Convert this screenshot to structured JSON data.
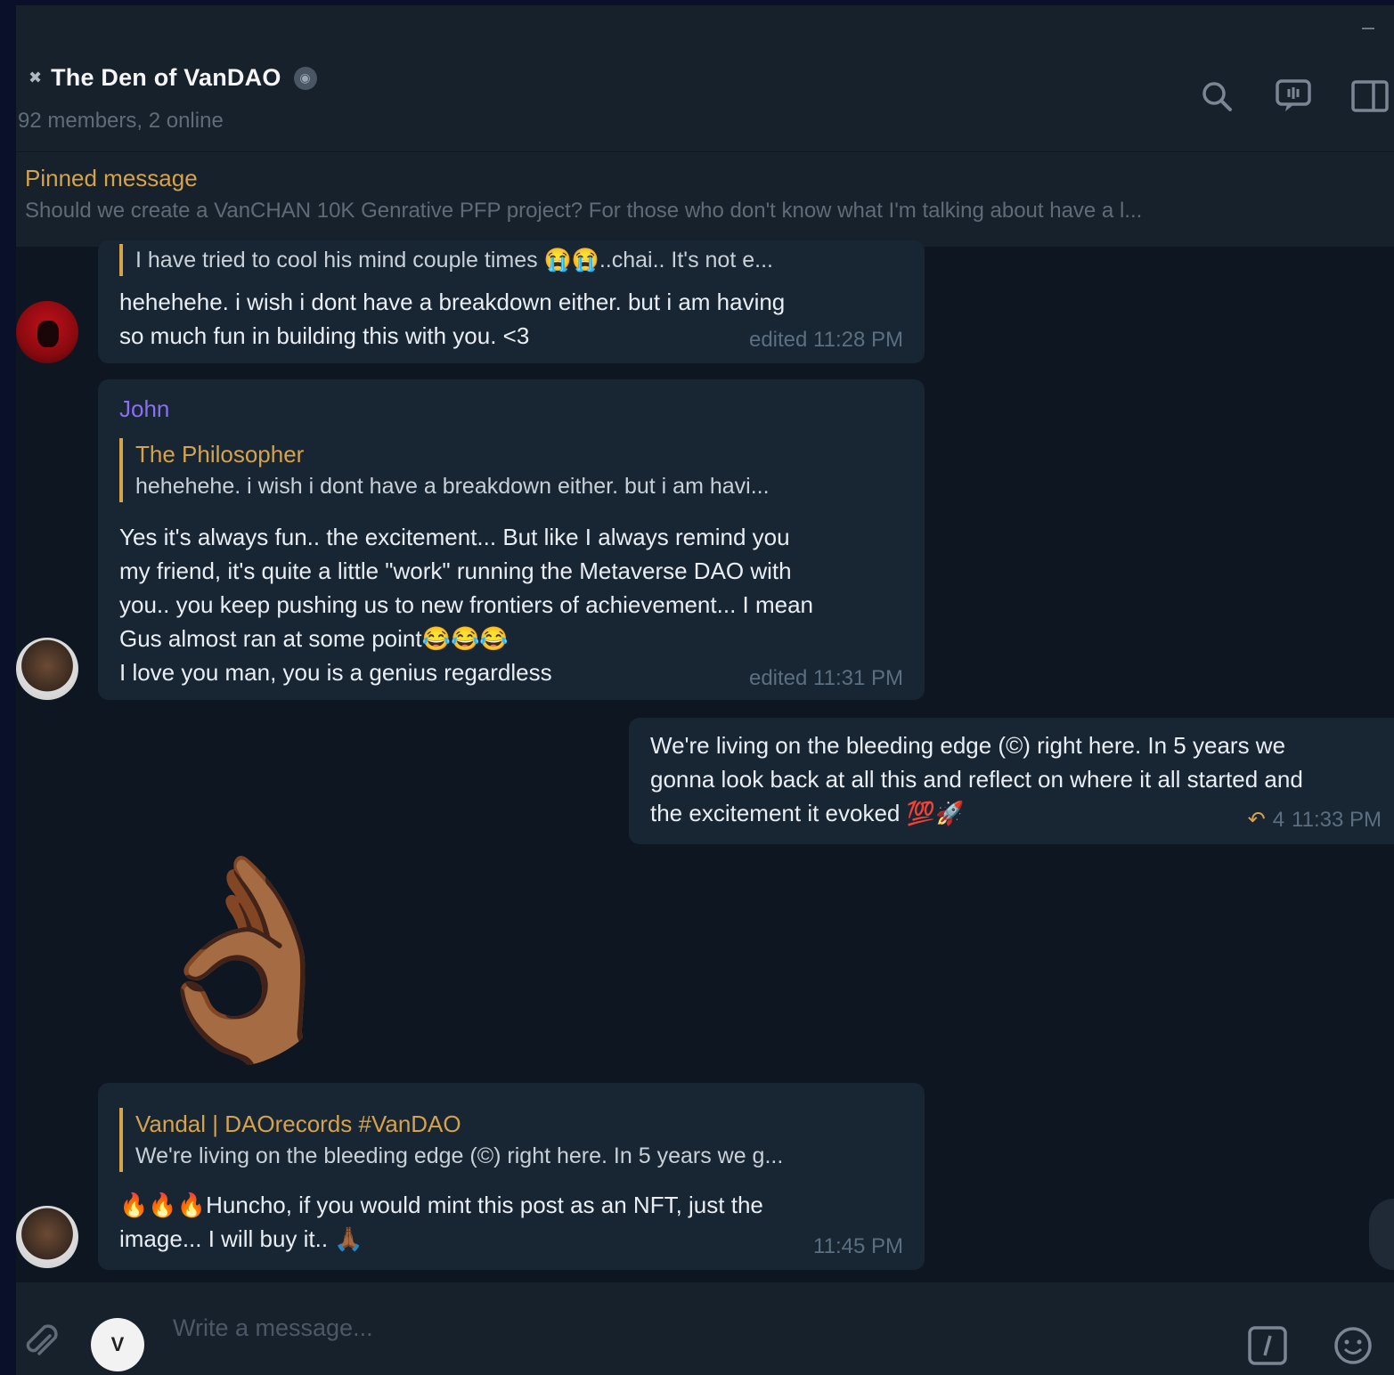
{
  "header": {
    "title": "The Den of VanDAO",
    "subtitle": "92 members, 2 online",
    "icons": [
      "search-icon",
      "video-chat-icon",
      "sidebar-toggle-icon"
    ]
  },
  "pinned": {
    "label": "Pinned message",
    "text": "Should we create a VanCHAN 10K Genrative PFP project? For those who don't know what I'm talking about have a l..."
  },
  "messages": {
    "m1": {
      "reply_text": "I have tried to cool his mind couple times 😭😭..chai.. It's not e...",
      "lines": [
        "hehehehe. i wish i dont have a breakdown either. but i am having",
        "so much fun in building this with you. <3"
      ],
      "time": "edited 11:28 PM"
    },
    "m2": {
      "sender": "John",
      "reply_name": "The Philosopher",
      "reply_text": "hehehehe. i wish i dont have a breakdown either. but i am havi...",
      "lines": [
        "Yes it's always fun.. the excitement... But like I always remind you",
        "my friend, it's quite a little \"work\" running the Metaverse DAO with",
        "you.. you keep pushing us to new frontiers of achievement... I mean",
        "Gus almost ran at some point😂😂😂",
        "I love you man, you is a genius regardless"
      ],
      "time": "edited 11:31 PM"
    },
    "m3": {
      "lines": [
        "We're living on the bleeding edge (©) right here. In 5 years we",
        "gonna look back at all this and reflect on where it all started and",
        "the excitement it evoked 💯🚀"
      ],
      "replies": "4",
      "time": "11:33 PM"
    },
    "m4": {
      "sticker": "👌🏾"
    },
    "m5": {
      "reply_name": "Vandal | DAOrecords #VanDAO",
      "reply_text": "We're living on the bleeding edge (©) right here. In 5 years we g...",
      "lines": [
        "🔥🔥🔥Huncho, if you would mint this post as an NFT, just the",
        "image... I will buy it.. 🙏🏾"
      ],
      "time": "11:45 PM"
    }
  },
  "composer": {
    "placeholder": "Write a message...",
    "avatar_text": "V"
  },
  "colors": {
    "accent": "#d6a24a",
    "sender_john": "#8a6ff0",
    "bg": "#0e1621",
    "panel": "#17212b"
  }
}
